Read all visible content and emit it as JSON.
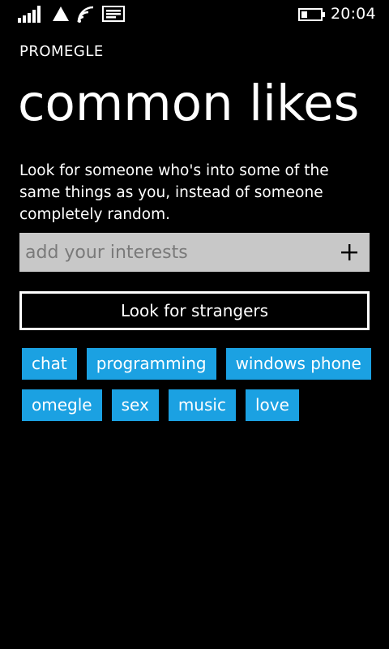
{
  "status_bar": {
    "time": "20:04",
    "icons": [
      "signal-strength-icon",
      "data-connection-icon",
      "wifi-icon",
      "message-icon",
      "battery-icon"
    ]
  },
  "app": {
    "name": "PROMEGLE",
    "page_title": "common likes",
    "description": "Look for someone who's into some of the same things as you, instead of someone completely random."
  },
  "interests_input": {
    "value": "",
    "placeholder": "add your interests",
    "add_icon": "plus-icon"
  },
  "look_button": {
    "label": "Look for strangers"
  },
  "tags": [
    [
      "chat",
      "programming",
      "windows phone"
    ],
    [
      "omegle",
      "sex",
      "music",
      "love"
    ]
  ],
  "colors": {
    "background": "#000000",
    "foreground": "#ffffff",
    "accent": "#1ba1e2",
    "input_background": "#c8c8c8",
    "placeholder": "#7a7a7a"
  }
}
